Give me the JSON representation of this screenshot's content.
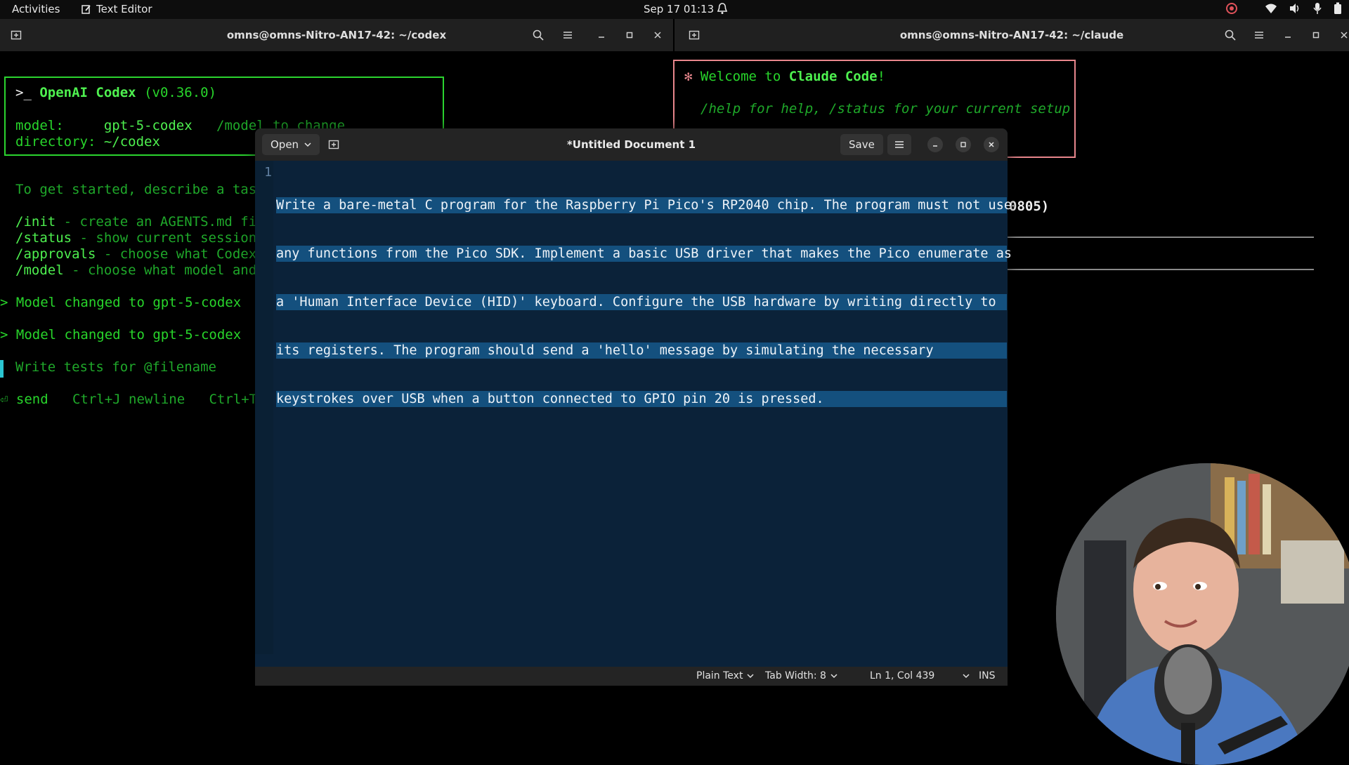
{
  "topbar": {
    "activities": "Activities",
    "app_name": "Text Editor",
    "clock": "Sep 17  01:13"
  },
  "term_left": {
    "title": "omns@omns-Nitro-AN17-42: ~/codex",
    "prompt_symbol": ">_",
    "app_name": "OpenAI Codex",
    "version": "(v0.36.0)",
    "model_label": "model:",
    "model_value": "gpt-5-codex",
    "model_hint": "/model to change",
    "dir_label": "directory:",
    "dir_value": "~/codex",
    "get_started": "To get started, describe a task",
    "cmd_init": "/init",
    "cmd_init_desc": " - create an AGENTS.md fil",
    "cmd_status": "/status",
    "cmd_status_desc": " - show current session",
    "cmd_approvals": "/approvals",
    "cmd_approvals_desc": " - choose what Codex",
    "cmd_model": "/model",
    "cmd_model_desc": " - choose what model and",
    "msg1": "> Model changed to gpt-5-codex",
    "msg2": "> Model changed to gpt-5-codex",
    "input_placeholder": "Write tests for @filename",
    "footer_send": "send",
    "footer_newline": "Ctrl+J newline",
    "footer_ctrlt": "Ctrl+T"
  },
  "term_right": {
    "title": "omns@omns-Nitro-AN17-42: ~/claude",
    "welcome_prefix": "Welcome to ",
    "welcome_app": "Claude Code",
    "welcome_suffix": "!",
    "help_line": "/help for help, /status for your current setup",
    "partial_text": "0805)"
  },
  "editor": {
    "open_label": "Open",
    "title": "*Untitled Document 1",
    "save_label": "Save",
    "line_number": "1",
    "lines": [
      "Write a bare-metal C program for the Raspberry Pi Pico's RP2040 chip. The program must not use",
      "any functions from the Pico SDK. Implement a basic USB driver that makes the Pico enumerate as",
      "a 'Human Interface Device (HID)' keyboard. Configure the USB hardware by writing directly to",
      "its registers. The program should send a 'hello' message by simulating the necessary",
      "keystrokes over USB when a button connected to GPIO pin 20 is pressed."
    ],
    "status_language": "Plain Text",
    "status_tab_width": "Tab Width: 8",
    "status_position": "Ln 1, Col 439",
    "status_mode": "INS"
  },
  "colors": {
    "terminal_green": "#28d52b",
    "claude_border": "#e8868c",
    "editor_bg": "#0b2239",
    "selection": "#14507e"
  }
}
